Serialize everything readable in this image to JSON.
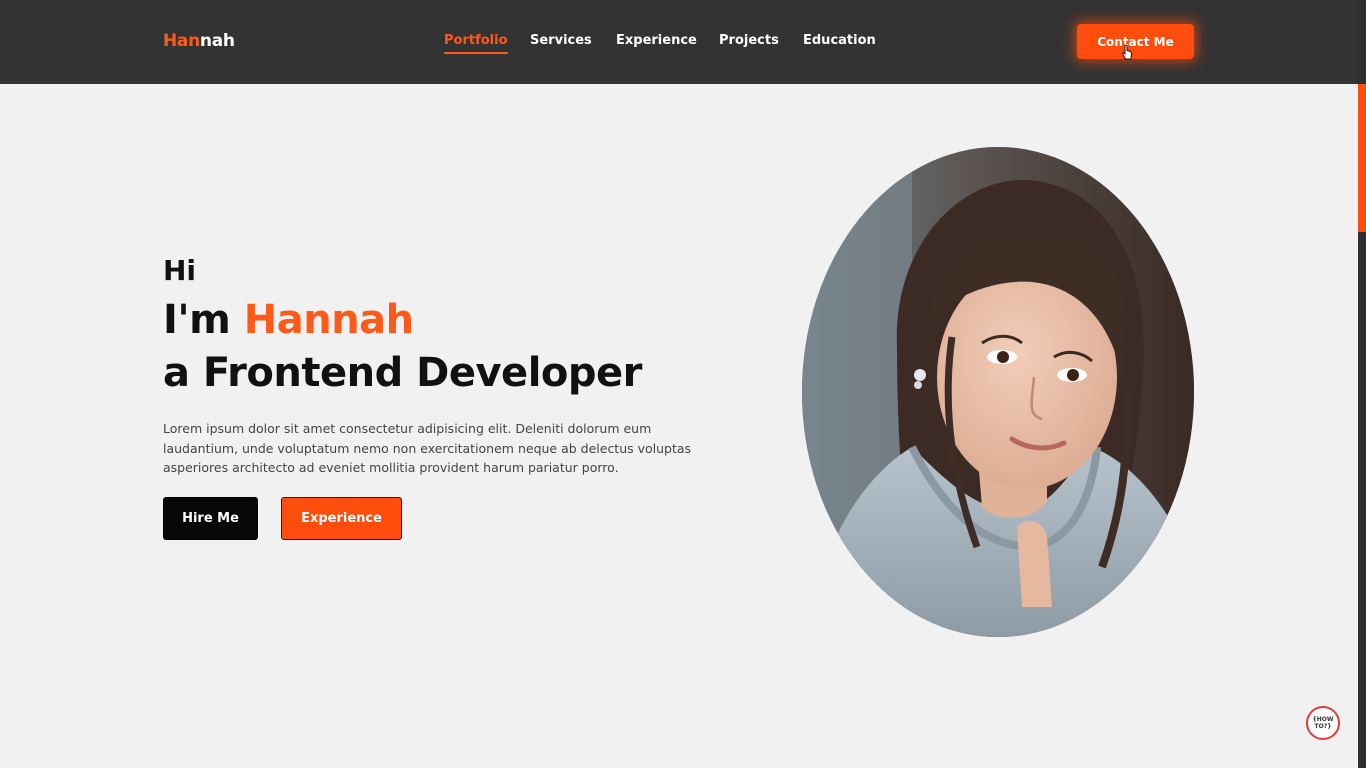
{
  "brand": {
    "logo_part1": "Han",
    "logo_part2": "nah"
  },
  "nav": {
    "items": [
      {
        "label": "Portfolio",
        "active": true
      },
      {
        "label": "Services",
        "active": false
      },
      {
        "label": "Experience",
        "active": false
      },
      {
        "label": "Projects",
        "active": false
      },
      {
        "label": "Education",
        "active": false
      }
    ],
    "contact_label": "Contact Me"
  },
  "hero": {
    "greeting": "Hi",
    "intro": "I'm",
    "name": "Hannah",
    "role": "a Frontend Developer",
    "description": "Lorem ipsum dolor sit amet consectetur adipisicing elit. Deleniti dolorum eum laudantium, unde voluptatum nemo non exercitationem neque ab delectus voluptas asperiores architecto ad eveniet mollitia provident harum pariatur porro.",
    "hire_label": "Hire Me",
    "experience_label": "Experience"
  },
  "badge": {
    "text": "{HOW TO?}"
  },
  "colors": {
    "accent": "#ff4d0d",
    "header_bg": "#333333",
    "page_bg": "#f1f1f1"
  },
  "icons": {
    "cursor": "hand-pointer-icon",
    "portrait": "profile-photo"
  }
}
